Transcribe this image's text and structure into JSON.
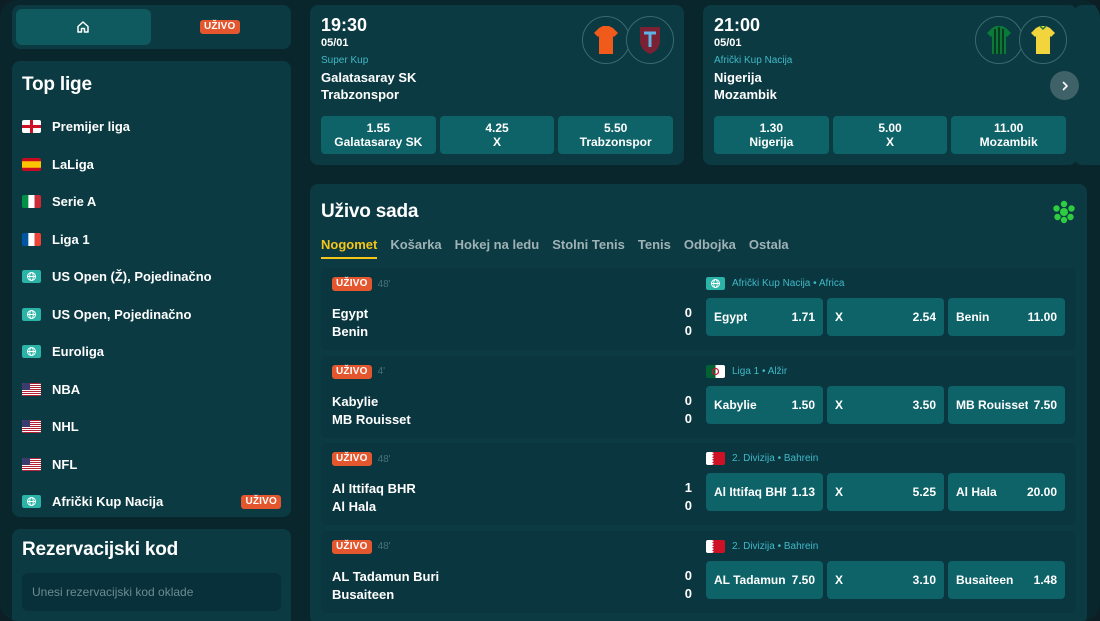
{
  "sidebar": {
    "tabs": {
      "live_label": "UŽIVO"
    },
    "top_leagues_title": "Top lige",
    "leagues": [
      {
        "name": "Premijer liga",
        "flag": "england"
      },
      {
        "name": "LaLiga",
        "flag": "spain"
      },
      {
        "name": "Serie A",
        "flag": "italy"
      },
      {
        "name": "Liga 1",
        "flag": "france"
      },
      {
        "name": "US Open (Ž), Pojedinačno",
        "flag": "globe"
      },
      {
        "name": "US Open, Pojedinačno",
        "flag": "globe"
      },
      {
        "name": "Euroliga",
        "flag": "globe"
      },
      {
        "name": "NBA",
        "flag": "usa"
      },
      {
        "name": "NHL",
        "flag": "usa"
      },
      {
        "name": "NFL",
        "flag": "usa"
      },
      {
        "name": "Afrički Kup Nacija",
        "flag": "globe",
        "live": "UŽIVO"
      }
    ],
    "reservation": {
      "title": "Rezervacijski kod",
      "placeholder": "Unesi rezervacijski kod oklade"
    }
  },
  "top_matches": [
    {
      "time": "19:30",
      "date": "05/01",
      "league": "Super Kup",
      "home": "Galatasaray SK",
      "away": "Trabzonspor",
      "odds": [
        {
          "value": "1.55",
          "label": "Galatasaray SK"
        },
        {
          "value": "4.25",
          "label": "X"
        },
        {
          "value": "5.50",
          "label": "Trabzonspor"
        }
      ]
    },
    {
      "time": "21:00",
      "date": "05/01",
      "league": "Afrički Kup Nacija",
      "home": "Nigerija",
      "away": "Mozambik",
      "odds": [
        {
          "value": "1.30",
          "label": "Nigerija"
        },
        {
          "value": "5.00",
          "label": "X"
        },
        {
          "value": "11.00",
          "label": "Mozambik"
        }
      ]
    }
  ],
  "live": {
    "title": "Uživo sada",
    "sports": [
      "Nogomet",
      "Košarka",
      "Hokej na ledu",
      "Stolni Tenis",
      "Tenis",
      "Odbojka",
      "Ostala"
    ],
    "live_label": "UŽIVO",
    "events": [
      {
        "minute": "48'",
        "home": "Egypt",
        "away": "Benin",
        "home_score": "0",
        "away_score": "0",
        "league": "Afrički Kup Nacija • Africa",
        "flag": "globe",
        "odds": [
          {
            "label": "Egypt",
            "value": "1.71"
          },
          {
            "label": "X",
            "value": "2.54"
          },
          {
            "label": "Benin",
            "value": "11.00"
          }
        ]
      },
      {
        "minute": "4'",
        "home": "Kabylie",
        "away": "MB Rouisset",
        "home_score": "0",
        "away_score": "0",
        "league": "Liga 1 • Alžir",
        "flag": "algeria",
        "odds": [
          {
            "label": "Kabylie",
            "value": "1.50"
          },
          {
            "label": "X",
            "value": "3.50"
          },
          {
            "label": "MB Rouisset",
            "value": "7.50"
          }
        ]
      },
      {
        "minute": "48'",
        "home": "Al Ittifaq BHR",
        "away": "Al Hala",
        "home_score": "1",
        "away_score": "0",
        "league": "2. Divizija • Bahrein",
        "flag": "bahrain",
        "odds": [
          {
            "label": "Al Ittifaq BHR",
            "value": "1.13"
          },
          {
            "label": "X",
            "value": "5.25"
          },
          {
            "label": "Al Hala",
            "value": "20.00"
          }
        ]
      },
      {
        "minute": "48'",
        "home": "AL Tadamun Buri",
        "away": "Busaiteen",
        "home_score": "0",
        "away_score": "0",
        "league": "2. Divizija • Bahrein",
        "flag": "bahrain",
        "odds": [
          {
            "label": "AL Tadamun Buri",
            "value": "7.50"
          },
          {
            "label": "X",
            "value": "3.10"
          },
          {
            "label": "Busaiteen",
            "value": "1.48"
          }
        ]
      }
    ]
  },
  "colors": {
    "background": "#08262c",
    "card": "#0b3a42",
    "odd_button": "#0e6368",
    "accent_yellow": "#f5c518",
    "live_badge": "#e4572e",
    "league_text": "#3fb9c6"
  },
  "icons": {
    "home": "home-icon",
    "next": "chevron-right-icon",
    "soccer": "soccer-ball-icon",
    "globe": "globe-icon"
  }
}
